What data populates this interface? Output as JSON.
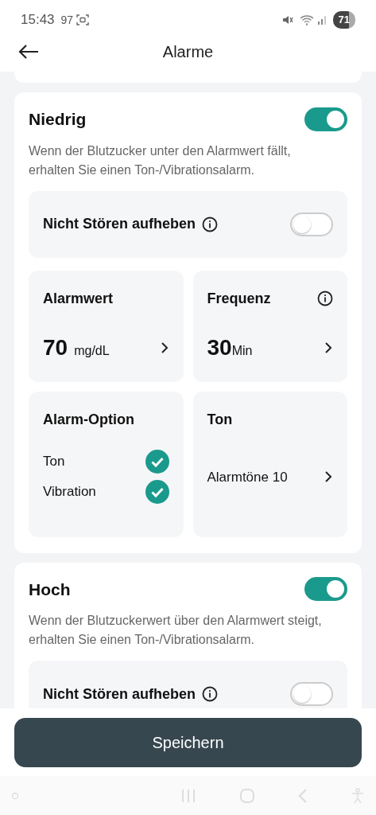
{
  "status_bar": {
    "time": "15:43",
    "extra": "97",
    "battery": "71"
  },
  "header": {
    "title": "Alarme"
  },
  "sections": [
    {
      "title": "Niedrig",
      "on": true,
      "description": "Wenn der Blutzucker unter den Alarmwert fällt, erhalten Sie einen Ton-/Vibrationsalarm.",
      "dnd": {
        "label": "Nicht Stören aufheben",
        "on": false
      },
      "alarm_value": {
        "label": "Alarmwert",
        "value": "70",
        "unit": "mg/dL"
      },
      "frequency": {
        "label": "Frequenz",
        "value": "30",
        "unit": "Min"
      },
      "alarm_option": {
        "label": "Alarm-Option",
        "options": [
          {
            "label": "Ton",
            "checked": true
          },
          {
            "label": "Vibration",
            "checked": true
          }
        ]
      },
      "tone": {
        "label": "Ton",
        "value": "Alarmtöne 10"
      }
    },
    {
      "title": "Hoch",
      "on": true,
      "description": "Wenn der Blutzuckerwert über den Alarmwert steigt, erhalten Sie einen Ton-/Vibrationsalarm.",
      "dnd": {
        "label": "Nicht Stören aufheben",
        "on": false
      }
    }
  ],
  "save_button": "Speichern"
}
